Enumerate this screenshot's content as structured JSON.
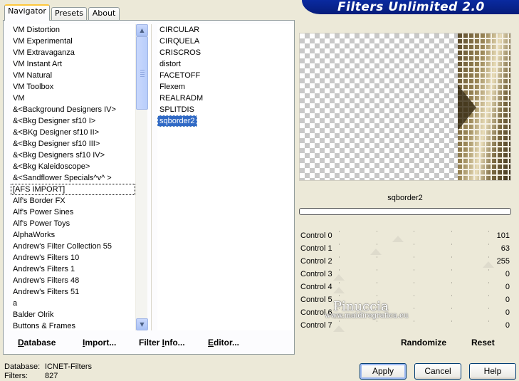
{
  "banner": {
    "title": "Filters Unlimited 2.0"
  },
  "tabs": [
    {
      "label": "Navigator",
      "active": true
    },
    {
      "label": "Presets",
      "active": false
    },
    {
      "label": "About",
      "active": false
    }
  ],
  "categories": {
    "items": [
      "VM Distortion",
      "VM Experimental",
      "VM Extravaganza",
      "VM Instant Art",
      "VM Natural",
      "VM Toolbox",
      "VM",
      "&<Background Designers IV>",
      "&<Bkg Designer sf10 I>",
      "&<BKg Designer sf10 II>",
      "&<Bkg Designer sf10 III>",
      "&<Bkg Designers sf10 IV>",
      "&<Bkg Kaleidoscope>",
      "&<Sandflower Specials^v^ >",
      "[AFS IMPORT]",
      "Alf's Border FX",
      "Alf's Power Sines",
      "Alf's Power Toys",
      "AlphaWorks",
      "Andrew's Filter Collection 55",
      "Andrew's Filters 10",
      "Andrew's Filters 1",
      "Andrew's Filters 48",
      "Andrew's Filters 51",
      "a",
      "Balder Olrik",
      "Buttons & Frames"
    ],
    "focused_index": 14
  },
  "filters": {
    "items": [
      "CIRCULAR",
      "CIRQUELA",
      "CRISCROS",
      "distort",
      "FACETOFF",
      "Flexem",
      "REALRADM",
      "SPLITDIS",
      "sqborder2"
    ],
    "selected_index": 8
  },
  "preview": {
    "filter_name": "sqborder2"
  },
  "controls": [
    {
      "label": "Control 0",
      "value": "101"
    },
    {
      "label": "Control 1",
      "value": "63"
    },
    {
      "label": "Control 2",
      "value": "255"
    },
    {
      "label": "Control 3",
      "value": "0"
    },
    {
      "label": "Control 4",
      "value": "0"
    },
    {
      "label": "Control 5",
      "value": "0"
    },
    {
      "label": "Control 6",
      "value": "0"
    },
    {
      "label": "Control 7",
      "value": "0"
    }
  ],
  "bottom_left": {
    "database_first": "D",
    "database_rest": "atabase",
    "import_first": "I",
    "import_rest": "mport...",
    "filterinfo_pre": "Filter ",
    "filterinfo_ul": "I",
    "filterinfo_post": "nfo...",
    "editor_first": "E",
    "editor_rest": "ditor..."
  },
  "bottom_right": {
    "randomize": "Randomize",
    "reset": "Reset"
  },
  "status": {
    "database_label": "Database:",
    "database_value": "ICNET-Filters",
    "filters_label": "Filters:",
    "filters_value": "827"
  },
  "buttons": {
    "apply": "Apply",
    "cancel": "Cancel",
    "help": "Help"
  },
  "watermark": {
    "line1": "Pinuccia",
    "line2": "www.maidiregrafica.eu"
  }
}
